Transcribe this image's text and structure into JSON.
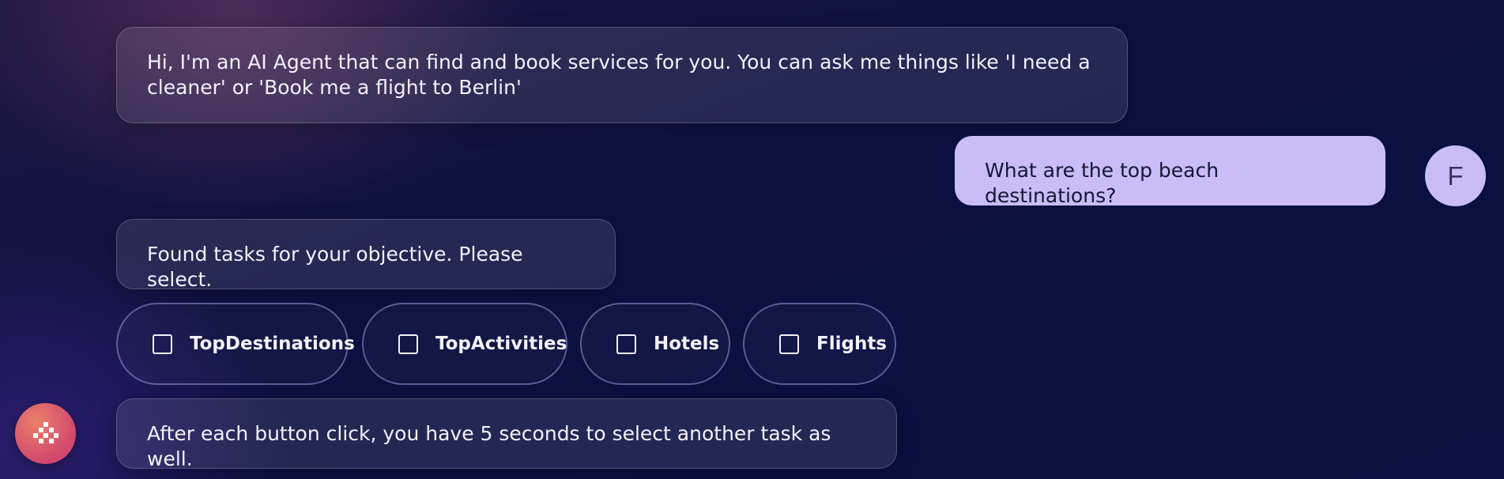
{
  "messages": {
    "agent_intro": "Hi, I'm an AI Agent that can find and book services for you. You can ask me things like 'I need a cleaner' or 'Book me a flight to Berlin'",
    "user_query": "What are the top beach destinations?",
    "agent_found": "Found tasks for your objective. Please select.",
    "agent_hint": "After each button click, you have 5 seconds to select another task as well."
  },
  "user": {
    "avatar_initial": "F"
  },
  "tasks": [
    {
      "label": "TopDestinations",
      "checked": false
    },
    {
      "label": "TopActivities",
      "checked": false
    },
    {
      "label": "Hotels",
      "checked": false
    },
    {
      "label": "Flights",
      "checked": false
    }
  ],
  "fab": {
    "icon": "assistant-icon"
  },
  "colors": {
    "user_bubble": "#c9bcf7",
    "fab_gradient": [
      "#e9806a",
      "#d2486e"
    ],
    "background": "#0c1040"
  }
}
